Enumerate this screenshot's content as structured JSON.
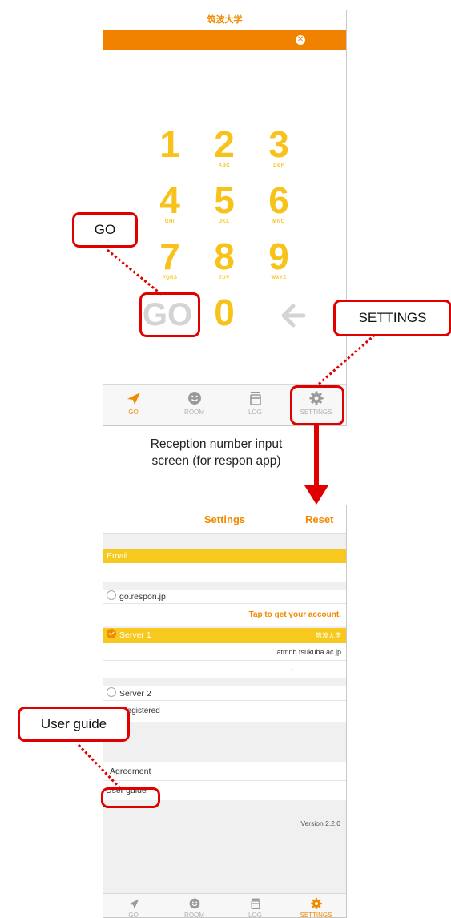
{
  "screen1": {
    "header_title": "筑波大学",
    "close_icon": "close-circle-icon",
    "keypad": {
      "keys": [
        {
          "digit": "1",
          "letters": ""
        },
        {
          "digit": "2",
          "letters": "ABC"
        },
        {
          "digit": "3",
          "letters": "DEF"
        },
        {
          "digit": "4",
          "letters": "GHI"
        },
        {
          "digit": "5",
          "letters": "JKL"
        },
        {
          "digit": "6",
          "letters": "MNO"
        },
        {
          "digit": "7",
          "letters": "PQRS"
        },
        {
          "digit": "8",
          "letters": "TUV"
        },
        {
          "digit": "9",
          "letters": "WXYZ"
        }
      ],
      "go_label": "GO",
      "zero": "0",
      "back_icon": "arrow-left-icon"
    },
    "tabs": [
      {
        "label": "GO",
        "icon": "paper-plane-icon",
        "active": true
      },
      {
        "label": "ROOM",
        "icon": "smiley-icon",
        "active": false
      },
      {
        "label": "LOG",
        "icon": "stack-icon",
        "active": false
      },
      {
        "label": "SETTINGS",
        "icon": "gear-icon",
        "active": false
      }
    ]
  },
  "caption": {
    "line1": "Reception number input",
    "line2": "screen (for respon app)"
  },
  "screen2": {
    "title": "Settings",
    "reset": "Reset",
    "email_section": "Email",
    "server_option_1": "go.respon.jp",
    "get_account_link": "Tap to get your account.",
    "server1_label": "Server 1",
    "server1_org": "筑波大学",
    "server1_host": "atmnb.tsukuba.ac.jp",
    "server1_extra": "-",
    "server2_label": "Server 2",
    "server2_status": "Not registered",
    "agreement": "Agreement",
    "user_guide": "User guide",
    "version": "Version 2.2.0",
    "tabs": [
      {
        "label": "GO",
        "icon": "paper-plane-icon",
        "active": false
      },
      {
        "label": "ROOM",
        "icon": "smiley-icon",
        "active": false
      },
      {
        "label": "LOG",
        "icon": "stack-icon",
        "active": false
      },
      {
        "label": "SETTINGS",
        "icon": "gear-icon",
        "active": true
      }
    ]
  },
  "callouts": {
    "go": "GO",
    "settings": "SETTINGS",
    "user_guide": "User guide"
  },
  "colors": {
    "accent": "#f08a00",
    "keypad_yellow": "#f7c31a",
    "section_yellow": "#f7c81e",
    "callout_red": "#e00000"
  }
}
